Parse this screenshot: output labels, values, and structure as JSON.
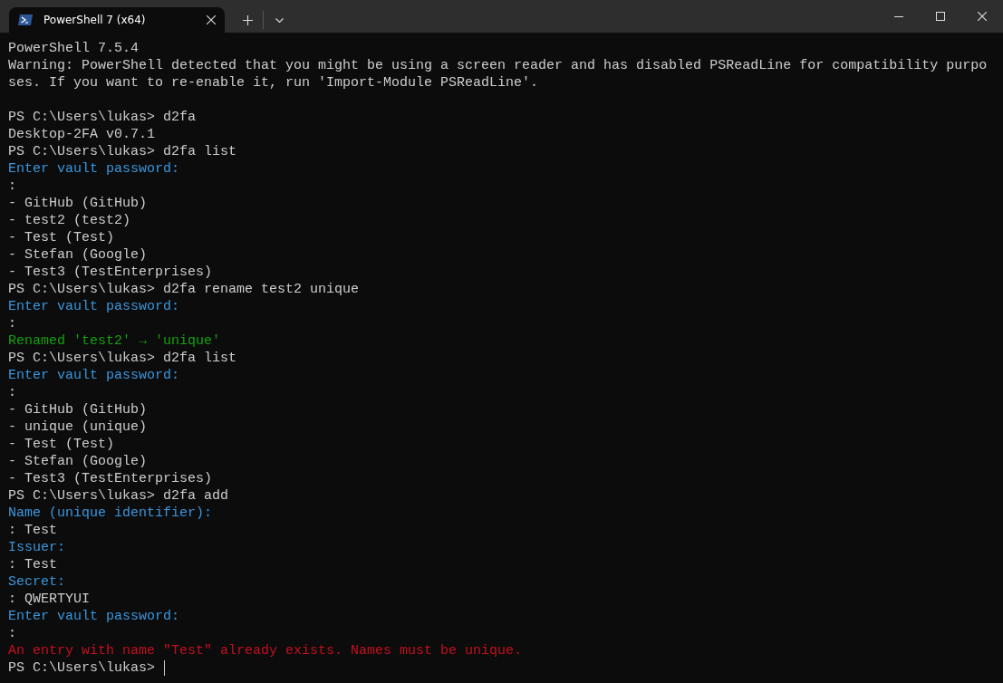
{
  "window": {
    "tab_title": "PowerShell 7 (x64)",
    "tab_selected": true
  },
  "terminal": {
    "cursor_visible": true,
    "lines": [
      {
        "kind": "plain",
        "text": "PowerShell 7.5.4"
      },
      {
        "kind": "plain",
        "text": "Warning: PowerShell detected that you might be using a screen reader and has disabled PSReadLine for compatibility purpo"
      },
      {
        "kind": "plain",
        "text": "ses. If you want to re-enable it, run 'Import-Module PSReadLine'."
      },
      {
        "kind": "blank"
      },
      {
        "kind": "plain",
        "text": "PS C:\\Users\\lukas> d2fa"
      },
      {
        "kind": "plain",
        "text": "Desktop-2FA v0.7.1"
      },
      {
        "kind": "plain",
        "text": "PS C:\\Users\\lukas> d2fa list"
      },
      {
        "kind": "info",
        "text": "Enter vault password:"
      },
      {
        "kind": "plain",
        "text": ":"
      },
      {
        "kind": "plain",
        "text": "- GitHub (GitHub)"
      },
      {
        "kind": "plain",
        "text": "- test2 (test2)"
      },
      {
        "kind": "plain",
        "text": "- Test (Test)"
      },
      {
        "kind": "plain",
        "text": "- Stefan (Google)"
      },
      {
        "kind": "plain",
        "text": "- Test3 (TestEnterprises)"
      },
      {
        "kind": "plain",
        "text": "PS C:\\Users\\lukas> d2fa rename test2 unique"
      },
      {
        "kind": "info",
        "text": "Enter vault password:"
      },
      {
        "kind": "plain",
        "text": ":"
      },
      {
        "kind": "success",
        "text": "Renamed 'test2' → 'unique'"
      },
      {
        "kind": "plain",
        "text": "PS C:\\Users\\lukas> d2fa list"
      },
      {
        "kind": "info",
        "text": "Enter vault password:"
      },
      {
        "kind": "plain",
        "text": ":"
      },
      {
        "kind": "plain",
        "text": "- GitHub (GitHub)"
      },
      {
        "kind": "plain",
        "text": "- unique (unique)"
      },
      {
        "kind": "plain",
        "text": "- Test (Test)"
      },
      {
        "kind": "plain",
        "text": "- Stefan (Google)"
      },
      {
        "kind": "plain",
        "text": "- Test3 (TestEnterprises)"
      },
      {
        "kind": "plain",
        "text": "PS C:\\Users\\lukas> d2fa add"
      },
      {
        "kind": "info",
        "text": "Name (unique identifier):"
      },
      {
        "kind": "plain",
        "text": ": Test"
      },
      {
        "kind": "info",
        "text": "Issuer:"
      },
      {
        "kind": "plain",
        "text": ": Test"
      },
      {
        "kind": "info",
        "text": "Secret:"
      },
      {
        "kind": "plain",
        "text": ": QWERTYUI"
      },
      {
        "kind": "info",
        "text": "Enter vault password:"
      },
      {
        "kind": "plain",
        "text": ":"
      },
      {
        "kind": "error",
        "text": "An entry with name \"Test\" already exists. Names must be unique."
      },
      {
        "kind": "plain",
        "text": "PS C:\\Users\\lukas> "
      }
    ]
  }
}
